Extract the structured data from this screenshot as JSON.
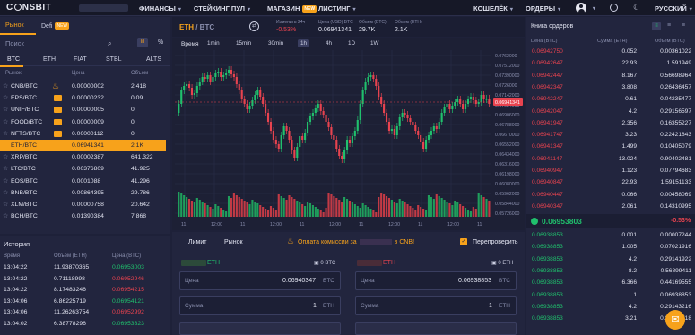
{
  "brand": {
    "name": "CONSBIT"
  },
  "nav": {
    "finance": "ФИНАНСЫ",
    "staking": "СТЕЙКИНГ ПУЛ",
    "shop": "МАГАЗИН",
    "shop_badge": "NEW",
    "listing": "ЛИСТИНГ",
    "wallet": "КОШЕЛЁК",
    "orders": "ОРДЕРЫ",
    "language": "РУССКИЙ"
  },
  "market_tabs": {
    "market": "Рынок",
    "defi": "Defi",
    "defi_badge": "NEW"
  },
  "search": {
    "placeholder": "Поиск"
  },
  "quote_tabs": [
    "BTC",
    "ETH",
    "FIAT",
    "STBL",
    "ALTS"
  ],
  "markets_header": {
    "pair": "Рынок",
    "price": "Цена",
    "volume": "Объем"
  },
  "markets": [
    {
      "pair": "CNB/BTC",
      "price": "0.00000002",
      "vol": "2.418",
      "badge": "fire"
    },
    {
      "pair": "EPS/BTC",
      "price": "0.00000232",
      "vol": "0.09",
      "badge": "orange"
    },
    {
      "pair": "UNIF/BTC",
      "price": "0.00000005",
      "vol": "0",
      "badge": "orange"
    },
    {
      "pair": "FOOD/BTC",
      "price": "0.00000009",
      "vol": "0",
      "badge": "orange"
    },
    {
      "pair": "NFTS/BTC",
      "price": "0.00000112",
      "vol": "0",
      "badge": "orange"
    },
    {
      "pair": "ETH/BTC",
      "price": "0.06941341",
      "vol": "2.1K",
      "badge": "",
      "active": true
    },
    {
      "pair": "XRP/BTC",
      "price": "0.00002387",
      "vol": "641.322",
      "badge": ""
    },
    {
      "pair": "LTC/BTC",
      "price": "0.00376809",
      "vol": "41.925",
      "badge": ""
    },
    {
      "pair": "EOS/BTC",
      "price": "0.0001088",
      "vol": "41.296",
      "badge": ""
    },
    {
      "pair": "BNB/BTC",
      "price": "0.00864395",
      "vol": "29.786",
      "badge": ""
    },
    {
      "pair": "XLM/BTC",
      "price": "0.00000758",
      "vol": "20.642",
      "badge": ""
    },
    {
      "pair": "BCH/BTC",
      "price": "0.01390384",
      "vol": "7.868",
      "badge": ""
    }
  ],
  "ticker": {
    "base": "ETH",
    "quote": "BTC",
    "change_label": "Изменить 24ч",
    "change": "-0.53%",
    "price_label": "Цена (USD) BTC",
    "price": "0.06941341",
    "volume_label": "Объем (BTC)",
    "volume": "29.7K",
    "volume2_label": "Объем (ETH)",
    "volume2": "2.1K"
  },
  "chart_tools": {
    "time": "Время",
    "intervals": [
      "1min",
      "15min",
      "30min",
      "1h",
      "4h",
      "1D",
      "1W"
    ],
    "active": "1h",
    "last_price": "0.06941341",
    "y_ticks": [
      "0.0762000",
      "0.07512000",
      "0.07390000",
      "0.0726000",
      "0.07142000",
      "0.07024000",
      "0.06906000",
      "0.06788000",
      "0.06670000",
      "0.06552000",
      "0.06434000",
      "0.06316000",
      "0.06198000",
      "0.06080000",
      "0.05962000",
      "0.05844000",
      "0.05726000"
    ],
    "x_ticks": [
      "11",
      "12:00",
      "11",
      "12:00",
      "11",
      "12:00",
      "11",
      "12:00",
      "11",
      "12:00",
      "11"
    ]
  },
  "history": {
    "title": "История",
    "col_time": "Время",
    "col_amount": "Объем (ETH)",
    "col_price": "Цена (BTC)",
    "rows": [
      {
        "t": "13:04:22",
        "a": "11.93870365",
        "p": "0.06953003",
        "s": "g"
      },
      {
        "t": "13:04:22",
        "a": "0.71118998",
        "p": "0.06952946",
        "s": "r"
      },
      {
        "t": "13:04:22",
        "a": "8.17483246",
        "p": "0.06954215",
        "s": "r"
      },
      {
        "t": "13:04:06",
        "a": "6.86225719",
        "p": "0.06954121",
        "s": "g"
      },
      {
        "t": "13:04:06",
        "a": "11.26263754",
        "p": "0.06952992",
        "s": "r"
      },
      {
        "t": "13:04:02",
        "a": "6.38778296",
        "p": "0.06953323",
        "s": "g"
      }
    ]
  },
  "trade": {
    "limit": "Лимит",
    "market": "Рынок",
    "fee_notice": "Оплата комиссии за",
    "fee_suffix": "в CNB!",
    "reverify": "Перепроверить",
    "buy_asset": "ETH",
    "sell_asset": "ETH",
    "buy_bal": "0 BTC",
    "sell_bal": "0 ETH",
    "price_label": "Цена",
    "buy_price": "0.06940347",
    "sell_price": "0.06938853",
    "price_unit": "BTC",
    "amount_label": "Сумма",
    "amount_value": "1",
    "amount_unit": "ETH"
  },
  "orderbook": {
    "title": "Книга ордеров",
    "col_price": "Цена (BTC)",
    "col_amount": "Сумма (ETH)",
    "col_total": "Объем (BTC)",
    "last": "0.06953803",
    "last_change": "-0.53%",
    "asks": [
      {
        "p": "0.06942750",
        "a": "0.052",
        "t": "0.00361022"
      },
      {
        "p": "0.06942647",
        "a": "22.93",
        "t": "1.591949"
      },
      {
        "p": "0.06942447",
        "a": "8.167",
        "t": "0.56698964"
      },
      {
        "p": "0.06942347",
        "a": "3.808",
        "t": "0.26436457"
      },
      {
        "p": "0.06942247",
        "a": "0.61",
        "t": "0.04235477"
      },
      {
        "p": "0.06942047",
        "a": "4.2",
        "t": "0.29156597"
      },
      {
        "p": "0.06941947",
        "a": "2.356",
        "t": "0.16355227"
      },
      {
        "p": "0.06941747",
        "a": "3.23",
        "t": "0.22421843"
      },
      {
        "p": "0.06941347",
        "a": "1.499",
        "t": "0.10405079"
      },
      {
        "p": "0.06941147",
        "a": "13.024",
        "t": "0.90402481"
      },
      {
        "p": "0.06940947",
        "a": "1.123",
        "t": "0.07794683"
      },
      {
        "p": "0.06940847",
        "a": "22.93",
        "t": "1.59151133"
      },
      {
        "p": "0.06940447",
        "a": "0.066",
        "t": "0.00458069"
      },
      {
        "p": "0.06940347",
        "a": "2.061",
        "t": "0.14310995"
      }
    ],
    "bids": [
      {
        "p": "0.06938853",
        "a": "0.001",
        "t": "0.00007244"
      },
      {
        "p": "0.06938853",
        "a": "1.005",
        "t": "0.07021916"
      },
      {
        "p": "0.06938853",
        "a": "4.2",
        "t": "0.29141922"
      },
      {
        "p": "0.06938853",
        "a": "8.2",
        "t": "0.56899411"
      },
      {
        "p": "0.06938853",
        "a": "6.366",
        "t": "0.44169555"
      },
      {
        "p": "0.06938853",
        "a": "1",
        "t": "0.06938853"
      },
      {
        "p": "0.06938853",
        "a": "4.2",
        "t": "0.29143216"
      },
      {
        "p": "0.06938853",
        "a": "3.21",
        "t": "0.22273718"
      }
    ]
  }
}
